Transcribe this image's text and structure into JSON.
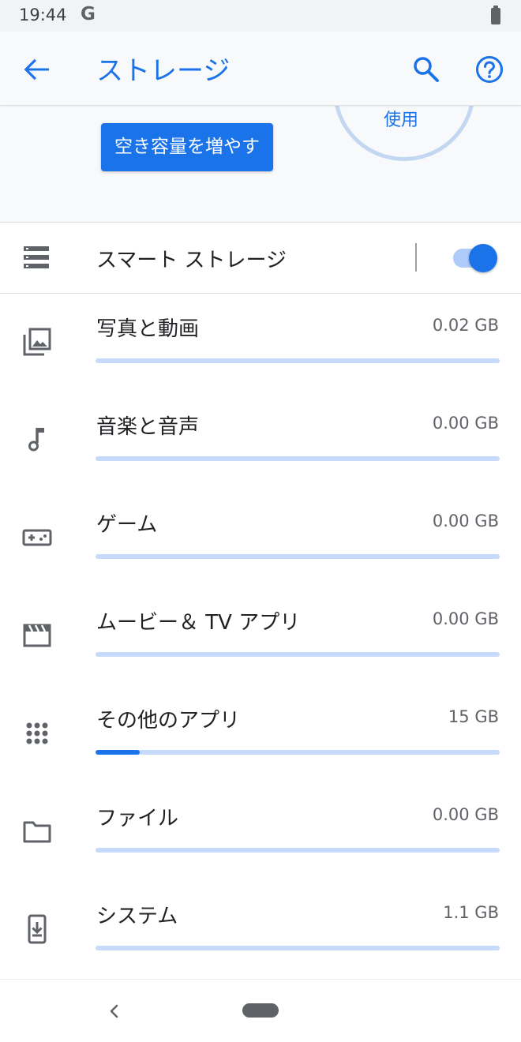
{
  "status_bar": {
    "time": "19:44",
    "g_logo": "G"
  },
  "app_bar": {
    "title": "ストレージ",
    "back_icon": "arrow-back-icon",
    "search_icon": "search-icon",
    "help_icon": "help-icon"
  },
  "header": {
    "usage_text": "使用",
    "free_up_button": "空き容量を増やす"
  },
  "smart_storage": {
    "label": "スマート ストレージ",
    "enabled": true
  },
  "categories": [
    {
      "label": "写真と動画",
      "size": "0.02 GB",
      "icon": "photo-icon",
      "fill": 0.0
    },
    {
      "label": "音楽と音声",
      "size": "0.00 GB",
      "icon": "music-note-icon",
      "fill": 0.0
    },
    {
      "label": "ゲーム",
      "size": "0.00 GB",
      "icon": "gamepad-icon",
      "fill": 0.0
    },
    {
      "label": "ムービー＆ TV アプリ",
      "size": "0.00 GB",
      "icon": "movie-icon",
      "fill": 0.0
    },
    {
      "label": "その他のアプリ",
      "size": "15 GB",
      "icon": "apps-icon",
      "fill": 0.11
    },
    {
      "label": "ファイル",
      "size": "0.00 GB",
      "icon": "folder-icon",
      "fill": 0.0
    },
    {
      "label": "システム",
      "size": "1.1 GB",
      "icon": "system-update-icon",
      "fill": 0.0
    }
  ],
  "colors": {
    "accent": "#1a73e8",
    "track": "#c6dafc",
    "icon": "#5f6368"
  }
}
